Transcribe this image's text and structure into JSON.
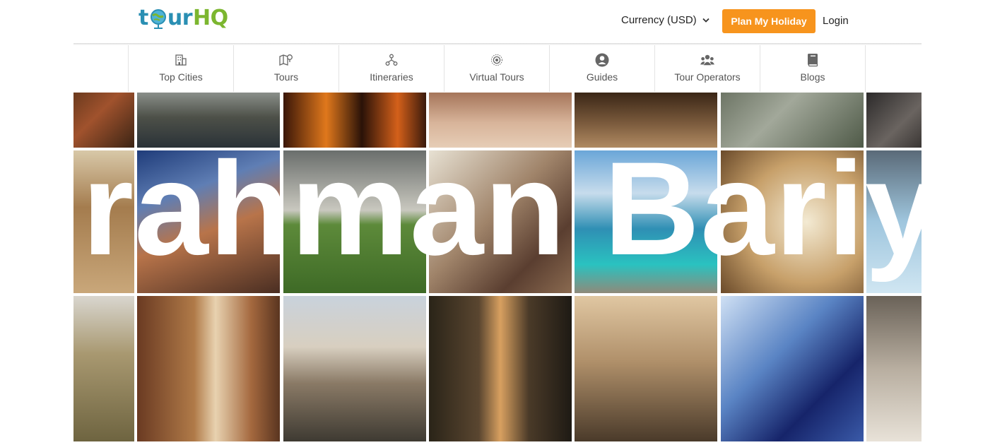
{
  "header": {
    "logo": {
      "t": "t",
      "o": "o",
      "ur": "ur",
      "hq": "HQ"
    },
    "currency_label": "Currency (USD)",
    "plan_button": "Plan My Holiday",
    "login": "Login"
  },
  "nav": {
    "items": [
      {
        "label": "Top Cities",
        "icon": "building-icon"
      },
      {
        "label": "Tours",
        "icon": "map-pin-icon"
      },
      {
        "label": "Itineraries",
        "icon": "route-nodes-icon"
      },
      {
        "label": "Virtual Tours",
        "icon": "radar-icon"
      },
      {
        "label": "Guides",
        "icon": "user-circle-icon"
      },
      {
        "label": "Tour Operators",
        "icon": "users-group-icon"
      },
      {
        "label": "Blogs",
        "icon": "book-icon"
      }
    ]
  },
  "hero": {
    "overlay_text": "rahman Bariy"
  },
  "colors": {
    "accent": "#f7941d",
    "logo_blue": "#2a8fb3",
    "logo_green": "#7cb62f"
  }
}
